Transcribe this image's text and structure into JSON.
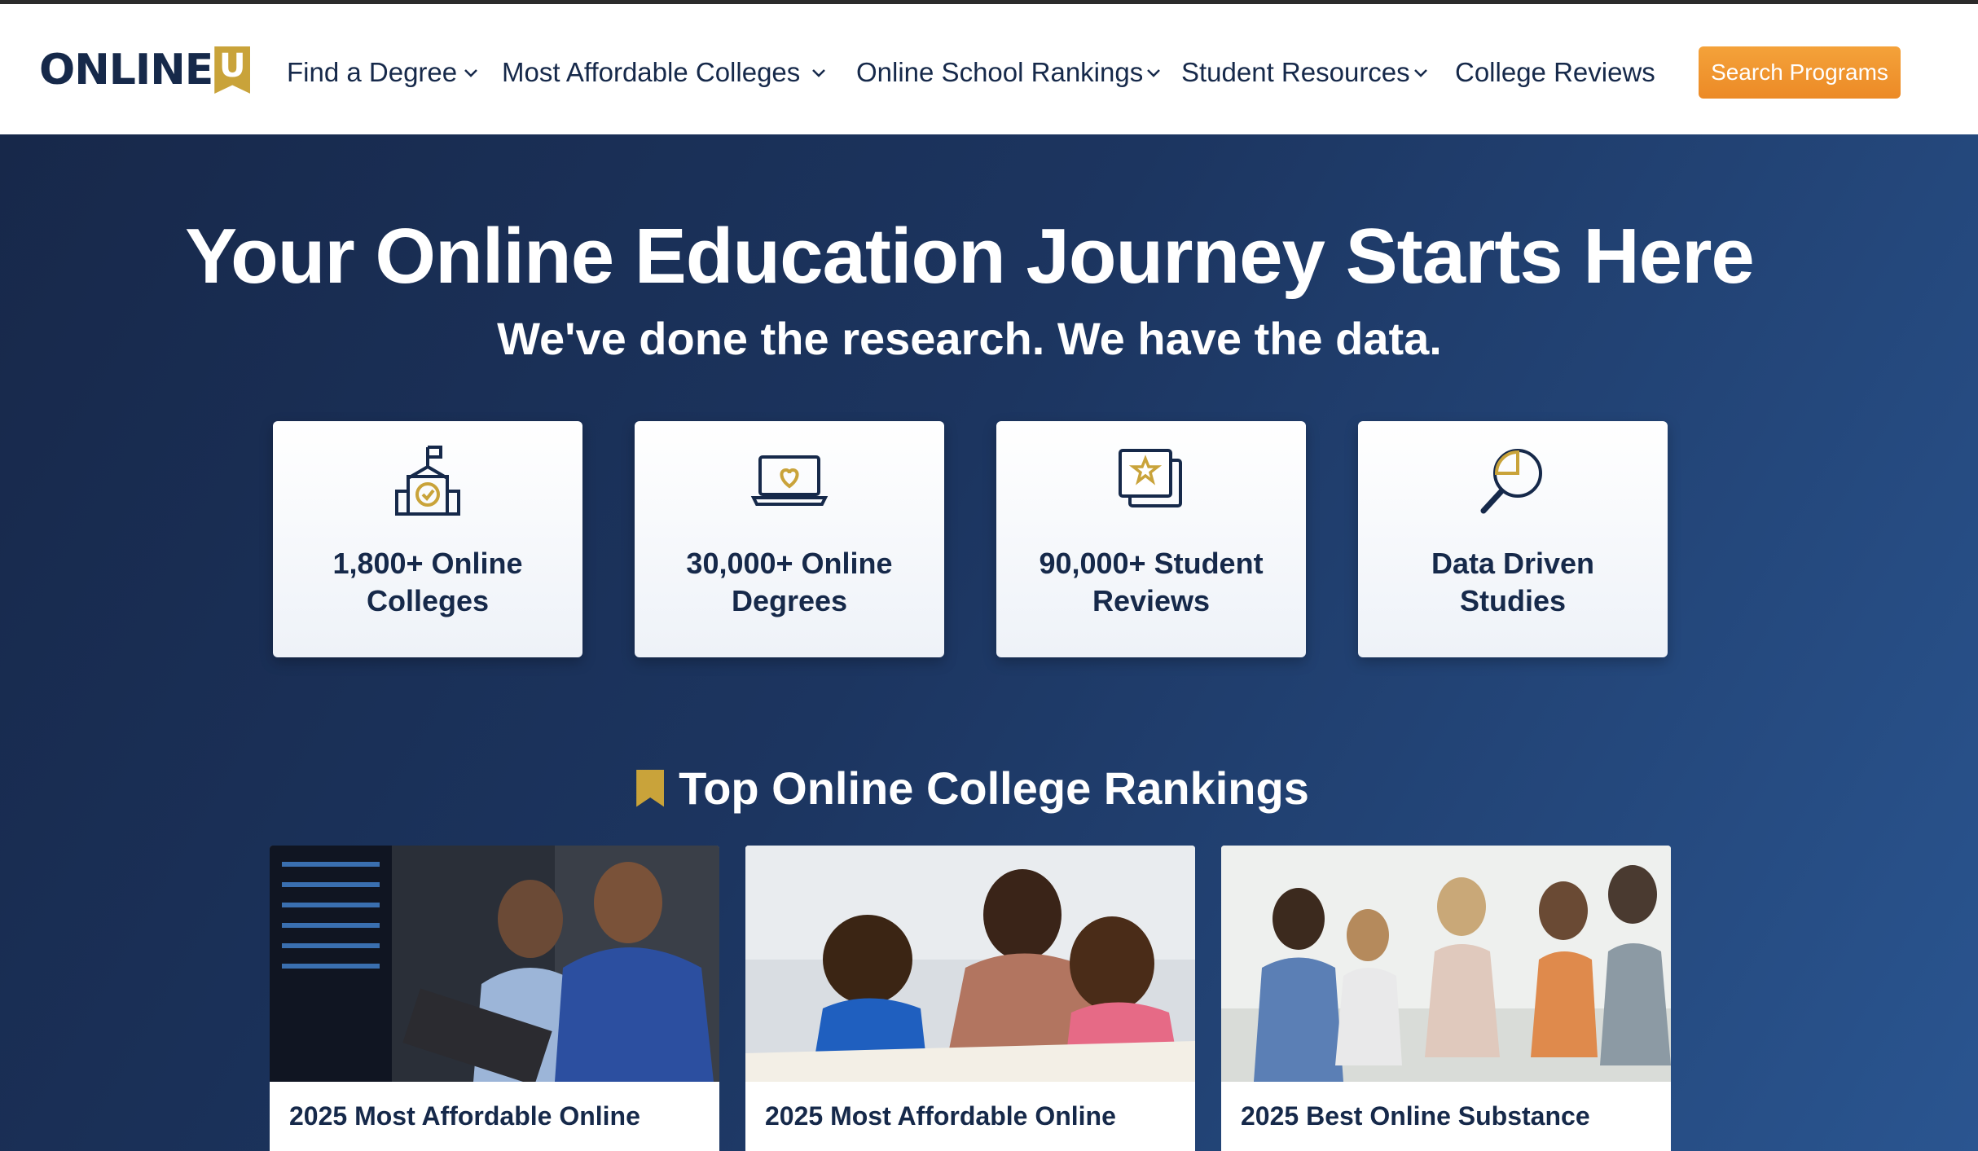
{
  "brand": {
    "name_main": "ONLINE",
    "name_badge": "U"
  },
  "nav": {
    "items": [
      {
        "label": "Find a Degree",
        "has_dropdown": true
      },
      {
        "label": "Most Affordable Colleges",
        "has_dropdown": true
      },
      {
        "label": "Online School Rankings",
        "has_dropdown": true
      },
      {
        "label": "Student Resources",
        "has_dropdown": true
      },
      {
        "label": "College Reviews",
        "has_dropdown": false
      }
    ],
    "cta_label": "Search Programs"
  },
  "hero": {
    "title": "Your Online Education Journey Starts Here",
    "subtitle": "We've done the research. We have the data."
  },
  "stats": [
    {
      "label": "1,800+ Online Colleges",
      "icon": "school-icon"
    },
    {
      "label": "30,000+ Online Degrees",
      "icon": "laptop-heart-icon"
    },
    {
      "label": "90,000+ Student Reviews",
      "icon": "star-review-icon"
    },
    {
      "label": "Data Driven Studies",
      "icon": "magnifier-chart-icon"
    }
  ],
  "rankings": {
    "heading": "Top Online College Rankings",
    "cards": [
      {
        "title": "2025 Most Affordable Online",
        "image": "photo-it-professionals-server-room"
      },
      {
        "title": "2025 Most Affordable Online",
        "image": "photo-teacher-with-children-classroom"
      },
      {
        "title": "2025 Best Online Substance",
        "image": "photo-group-therapy-circle"
      }
    ]
  },
  "colors": {
    "navy": "#16294a",
    "gold": "#c9a33a",
    "cta_orange": "#f09530",
    "hero_start": "#17284a",
    "hero_end": "#2a5590"
  }
}
